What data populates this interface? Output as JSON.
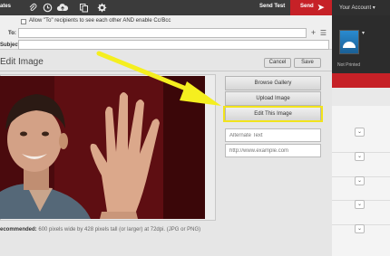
{
  "toolbar": {
    "partial_label": "ates",
    "icons": [
      "paperclip-icon",
      "clock-icon",
      "cloud-upload-icon",
      "copy-icon",
      "gear-icon"
    ],
    "send_test_label": "Send Test",
    "send_label": "Send",
    "account_label": "Your Account ▾"
  },
  "recipients": {
    "allow_to_label": "Allow \"To\" recipients to see each other AND enable Cc/Bcc",
    "to_label": "To:",
    "to_value": "",
    "subject_label": "Subject:",
    "subject_value": ""
  },
  "edit_image": {
    "title": "Edit Image",
    "cancel_label": "Cancel",
    "save_label": "Save",
    "browse_gallery_label": "Browse Gallery",
    "upload_image_label": "Upload Image",
    "edit_this_image_label": "Edit This Image",
    "alt_text_placeholder": "Alternate Text",
    "url_placeholder": "http://www.example.com",
    "recommended_prefix": "ecommended:",
    "recommended_text": "600 pixels wide by 428 pixels tall (or larger) at 72dpi. (JPG or PNG)"
  },
  "right_panel": {
    "thumb_label": "Not Printed",
    "thumb_dropdown": "▾"
  },
  "colors": {
    "send_red": "#c62127",
    "highlight_yellow": "#f2e41b",
    "arrow_yellow": "#f5ef1f"
  }
}
